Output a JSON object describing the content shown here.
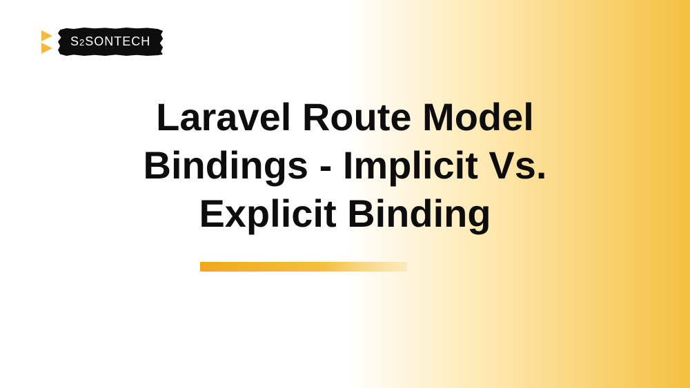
{
  "logo": {
    "text_part1": "S",
    "text_part2": "2",
    "text_part3": "SONTECH"
  },
  "heading": {
    "line1": "Laravel Route Model",
    "line2": "Bindings - Implicit Vs.",
    "line3": "Explicit Binding"
  },
  "colors": {
    "accent": "#f4c040",
    "text": "#0d0d0d"
  }
}
